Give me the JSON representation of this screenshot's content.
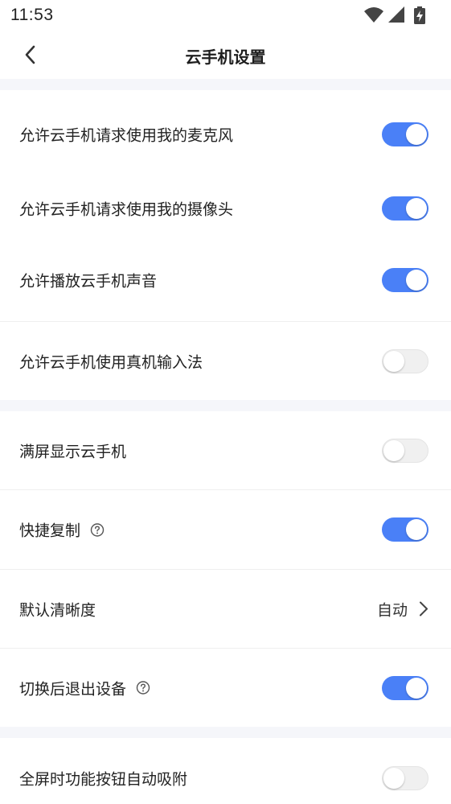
{
  "status_bar": {
    "time": "11:53"
  },
  "header": {
    "title": "云手机设置"
  },
  "settings": {
    "microphone": {
      "label": "允许云手机请求使用我的麦克风",
      "on": true
    },
    "camera": {
      "label": "允许云手机请求使用我的摄像头",
      "on": true
    },
    "sound": {
      "label": "允许播放云手机声音",
      "on": true
    },
    "input_method": {
      "label": "允许云手机使用真机输入法",
      "on": false
    },
    "fullscreen": {
      "label": "满屏显示云手机",
      "on": false
    },
    "quick_copy": {
      "label": "快捷复制",
      "on": true
    },
    "clarity": {
      "label": "默认清晰度",
      "value": "自动"
    },
    "exit_on_switch": {
      "label": "切换后退出设备",
      "on": true
    },
    "auto_snap": {
      "label": "全屏时功能按钮自动吸附",
      "on": false
    }
  },
  "colors": {
    "accent": "#4a80f7",
    "section_gap": "#f5f6fa"
  }
}
